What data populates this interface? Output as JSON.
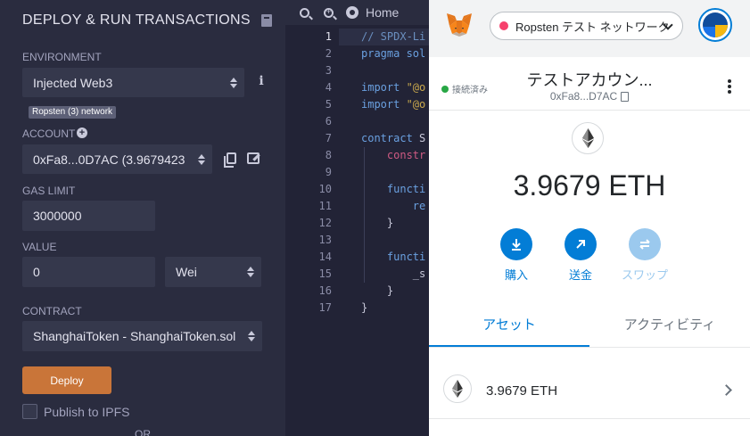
{
  "remix": {
    "panel_title": "DEPLOY & RUN TRANSACTIONS",
    "environment_label": "ENVIRONMENT",
    "environment_value": "Injected Web3",
    "network_badge": "Ropsten (3) network",
    "account_label": "ACCOUNT",
    "account_value": "0xFa8...0D7AC (3.9679423",
    "gas_limit_label": "GAS LIMIT",
    "gas_limit_value": "3000000",
    "value_label": "VALUE",
    "value_amount": "0",
    "value_unit": "Wei",
    "contract_label": "CONTRACT",
    "contract_value": "ShanghaiToken - ShanghaiToken.sol",
    "deploy_label": "Deploy",
    "ipfs_label": "Publish to IPFS",
    "or_label": "OR"
  },
  "editor": {
    "tab_home": "Home",
    "line_numbers": [
      "1",
      "2",
      "3",
      "4",
      "5",
      "6",
      "7",
      "8",
      "9",
      "10",
      "11",
      "12",
      "13",
      "14",
      "15",
      "16",
      "17"
    ],
    "lines": {
      "l1": "// SPDX-Li",
      "l2a": "pragma",
      "l2b": " sol",
      "l4a": "import",
      "l4b": " \"@o",
      "l5a": "import",
      "l5b": " \"@o",
      "l7a": "contract",
      "l7b": " S",
      "l8": "    constr",
      "l10": "    functi",
      "l11": "        re",
      "l12": "    }",
      "l14": "    functi",
      "l15": "        _s",
      "l16": "    }",
      "l17": "}"
    }
  },
  "metamask": {
    "network_name": "Ropsten テスト ネットワーク",
    "connected_label": "接続済み",
    "account_name": "テストアカウン...",
    "account_address": "0xFa8...D7AC",
    "balance": "3.9679 ETH",
    "actions": {
      "buy": "購入",
      "send": "送金",
      "swap": "スワップ"
    },
    "tabs": {
      "assets": "アセット",
      "activity": "アクティビティ"
    },
    "asset_balance": "3.9679 ETH",
    "colors": {
      "primary": "#037dd6",
      "disabled": "#9bc9ee",
      "network_dot": "#f6416c",
      "connected": "#28a745"
    }
  }
}
